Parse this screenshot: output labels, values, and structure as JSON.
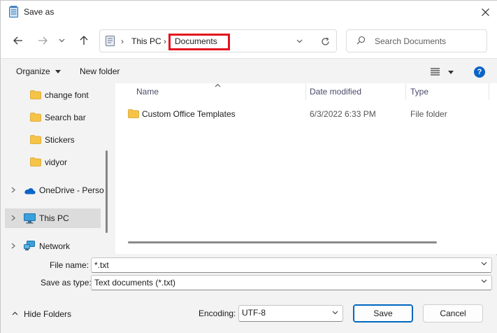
{
  "window": {
    "title": "Save as"
  },
  "address": {
    "root": "This PC",
    "current": "Documents"
  },
  "search": {
    "placeholder": "Search Documents"
  },
  "commands": {
    "organize": "Organize",
    "new_folder": "New folder"
  },
  "sidebar": {
    "items": [
      {
        "label": "change font",
        "type": "folder"
      },
      {
        "label": "Search bar",
        "type": "folder"
      },
      {
        "label": "Stickers",
        "type": "folder"
      },
      {
        "label": "vidyor",
        "type": "folder"
      },
      {
        "label": "OneDrive - Perso",
        "type": "onedrive"
      },
      {
        "label": "This PC",
        "type": "pc",
        "selected": true
      },
      {
        "label": "Network",
        "type": "network"
      }
    ]
  },
  "columns": {
    "name": "Name",
    "date_modified": "Date modified",
    "type": "Type"
  },
  "files": [
    {
      "name": "Custom Office Templates",
      "date_modified": "6/3/2022 6:33 PM",
      "type": "File folder"
    }
  ],
  "form": {
    "file_name_label": "File name:",
    "file_name_value": "*.txt",
    "save_type_label": "Save as type:",
    "save_type_value": "Text documents (*.txt)",
    "encoding_label": "Encoding:",
    "encoding_value": "UTF-8"
  },
  "footer": {
    "hide_folders": "Hide Folders",
    "save": "Save",
    "cancel": "Cancel"
  },
  "colors": {
    "accent": "#0067c0",
    "highlight_box": "#e3121e",
    "folder": "#f5c346"
  }
}
